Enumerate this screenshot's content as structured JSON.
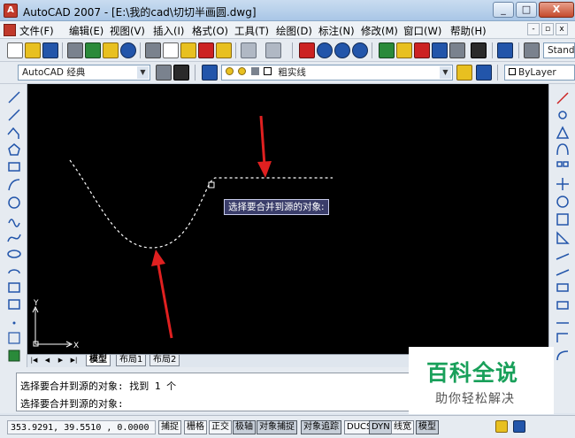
{
  "window": {
    "title": "AutoCAD 2007 - [E:\\我的cad\\切切半画圆.dwg]",
    "min_glyph": "_",
    "max_glyph": "□",
    "close_glyph": "X"
  },
  "menu": {
    "items": [
      "文件(F)",
      "编辑(E)",
      "视图(V)",
      "插入(I)",
      "格式(O)",
      "工具(T)",
      "绘图(D)",
      "标注(N)",
      "修改(M)",
      "窗口(W)",
      "帮助(H)"
    ],
    "doc_min_glyph": "-",
    "doc_restore_glyph": "▫",
    "doc_close_glyph": "x"
  },
  "toolbar": {
    "text_style_combo": "Stand",
    "workspace_combo": "AutoCAD 经典",
    "layer_combo": "粗实线",
    "color_combo": "ByLayer",
    "colors": {
      "red": "#cc2222",
      "blue": "#2255aa",
      "green": "#2a8a3a",
      "yellow": "#e8c020",
      "gray": "#7a828e"
    }
  },
  "canvas": {
    "background": "#000000",
    "tooltip": "选择要合并到源的对象:",
    "ucs_y": "Y",
    "ucs_x": "X",
    "arrow_color": "#e02020"
  },
  "tabs": {
    "nav": [
      "|◀",
      "◀",
      "▶",
      "▶|"
    ],
    "items": [
      "模型",
      "布局1",
      "布局2"
    ]
  },
  "command": {
    "line1": "选择要合并到源的对象:  找到 1 个",
    "line2": "选择要合并到源的对象:"
  },
  "status": {
    "coords": "353.9291, 39.5510 , 0.0000",
    "buttons": [
      "捕捉",
      "栅格",
      "正交",
      "极轴",
      "对象捕捉",
      "对象追踪",
      "DUCS",
      "DYN",
      "线宽",
      "模型"
    ]
  },
  "watermark": {
    "title": "百科全说",
    "subtitle": "助你轻松解决"
  }
}
